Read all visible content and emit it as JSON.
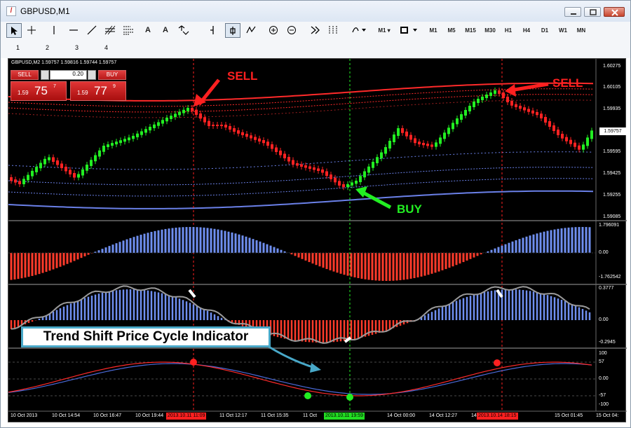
{
  "window": {
    "title": "GBPUSD,M1",
    "icon": "chart-window-icon"
  },
  "toolbar": {
    "tools": [
      "cursor-icon",
      "crosshair-icon",
      "vertical-line-icon",
      "horizontal-line-icon",
      "trendline-icon",
      "fibonacci-icon",
      "channel-icon",
      "text-icon",
      "text-label-icon",
      "arrows-icon",
      "period-separator-icon",
      "auto-scroll-icon",
      "indicator-icon",
      "zoom-in-icon",
      "zoom-out-icon",
      "chart-shift-icon",
      "grid-icon",
      "indicators-dropdown-icon"
    ],
    "period_dropdown": "M1",
    "chart_type_icon": "color-box-icon",
    "timeframes": [
      "M1",
      "M5",
      "M15",
      "M30",
      "H1",
      "H4",
      "D1",
      "W1",
      "MN"
    ]
  },
  "number_row": [
    "1",
    "2",
    "3",
    "4"
  ],
  "chart": {
    "instrument_info": "GBPUSD,M2  1.59757  1.59816  1.59744  1.59757",
    "trade_panel": {
      "sell_label": "SELL",
      "buy_label": "BUY",
      "lot_value": "0.20",
      "sell_price_small": "1.59",
      "sell_price_big": "75",
      "sell_price_sup": "7",
      "buy_price_small": "1.59",
      "buy_price_big": "77",
      "buy_price_sup": "9"
    },
    "price_axis": [
      "1.60275",
      "1.60105",
      "1.59935",
      "1.59757",
      "1.59595",
      "1.59425",
      "1.59255",
      "1.59085"
    ],
    "current_price": "1.59757",
    "osc1_axis": [
      "1.796091",
      "0.00",
      "-1.762542"
    ],
    "osc2_axis": [
      "0.3777",
      "0.00",
      "-0.2945"
    ],
    "osc3_axis": [
      "100",
      "57",
      "0.00",
      "-57",
      "-100"
    ],
    "time_labels": [
      "10 Oct 2013",
      "10 Oct 14:54",
      "10 Oct 16:47",
      "10 Oct 19:44",
      "11 Oct 12:17",
      "11 Oct 15:35",
      "11 Oct",
      "14 Oct 00:00",
      "14 Oct 12:27",
      "14 Oct",
      "15 Oct 01:45",
      "15 Oct 04:"
    ],
    "time_highlights": [
      {
        "text": "2013.10.11 11:09",
        "color": "#ff2020"
      },
      {
        "text": "2013.10.11 19:59",
        "color": "#22dd22"
      },
      {
        "text": "2013.10.14 18:15",
        "color": "#ff2020"
      }
    ],
    "annotations": {
      "sell_left": "SELL",
      "sell_right": "SELL",
      "buy": "BUY",
      "callout": "Trend Shift Price Cycle Indicator"
    },
    "colors": {
      "bull": "#22ee22",
      "bear": "#ff2222",
      "hist_pos": "#6f8ff0",
      "hist_neg": "#ff3b2b",
      "band_red": "#ff2a2a",
      "band_blue": "#6a80e8",
      "callout_border": "#48a8c8"
    }
  }
}
